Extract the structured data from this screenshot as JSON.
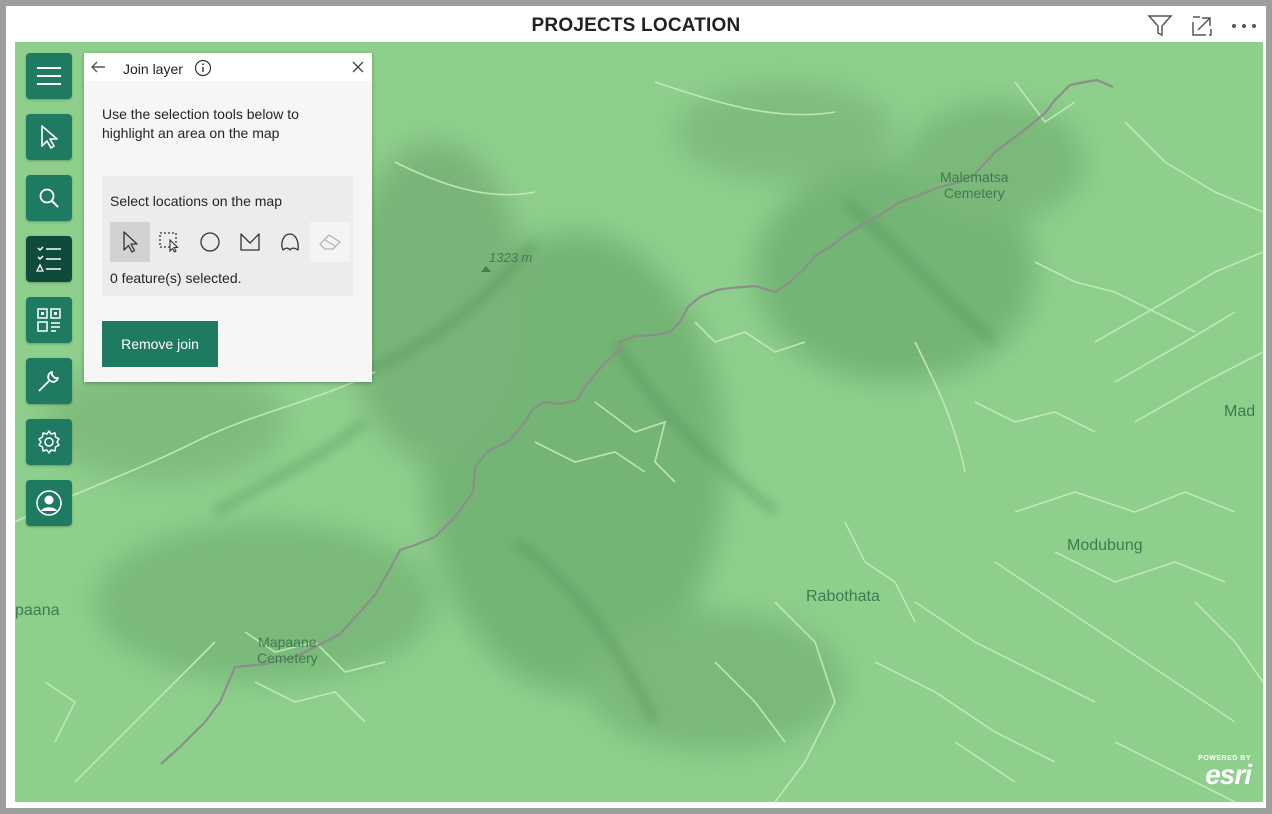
{
  "header": {
    "title": "PROJECTS LOCATION",
    "icons": [
      "filter-icon",
      "expand-icon",
      "more-options-icon"
    ]
  },
  "toolbar": {
    "items": [
      {
        "name": "menu",
        "icon": "hamburger-icon",
        "active": false
      },
      {
        "name": "select",
        "icon": "pointer-icon",
        "active": false
      },
      {
        "name": "search",
        "icon": "search-icon",
        "active": false
      },
      {
        "name": "layers",
        "icon": "layer-list-icon",
        "active": true
      },
      {
        "name": "analytics",
        "icon": "grid-analysis-icon",
        "active": false
      },
      {
        "name": "tools",
        "icon": "wrench-icon",
        "active": false
      },
      {
        "name": "settings",
        "icon": "gear-icon",
        "active": false
      },
      {
        "name": "account",
        "icon": "user-icon",
        "active": false
      }
    ]
  },
  "panel": {
    "title": "Join layer",
    "instruction": "Use the selection tools below to highlight an area on the map",
    "select_title": "Select locations on the map",
    "tools": [
      "pointer-select",
      "rectangle-select",
      "circle-select",
      "polygon-select",
      "lasso-select",
      "eraser"
    ],
    "count_text": "0 feature(s) selected.",
    "remove_button": "Remove join"
  },
  "map": {
    "labels": {
      "malematsa": "Malematsa Cemetery",
      "malematsa_l1": "Malematsa",
      "malematsa_l2": "Cemetery",
      "elevation": "1323 m",
      "mad": "Mad",
      "modubung": "Modubung",
      "rabothata": "Rabothata",
      "paana": "paana",
      "mapaane_l1": "Mapaane",
      "mapaane_l2": "Cemetery"
    },
    "colors": {
      "base": "#8ecf8c",
      "dark": "#5f9f63",
      "roads": "#c5ebbf",
      "main_road": "#8a8f89"
    },
    "attribution": {
      "powered": "POWERED BY",
      "brand": "esri"
    }
  },
  "colors": {
    "accent": "#1f7a62",
    "accent_active": "#0f4b3b"
  }
}
